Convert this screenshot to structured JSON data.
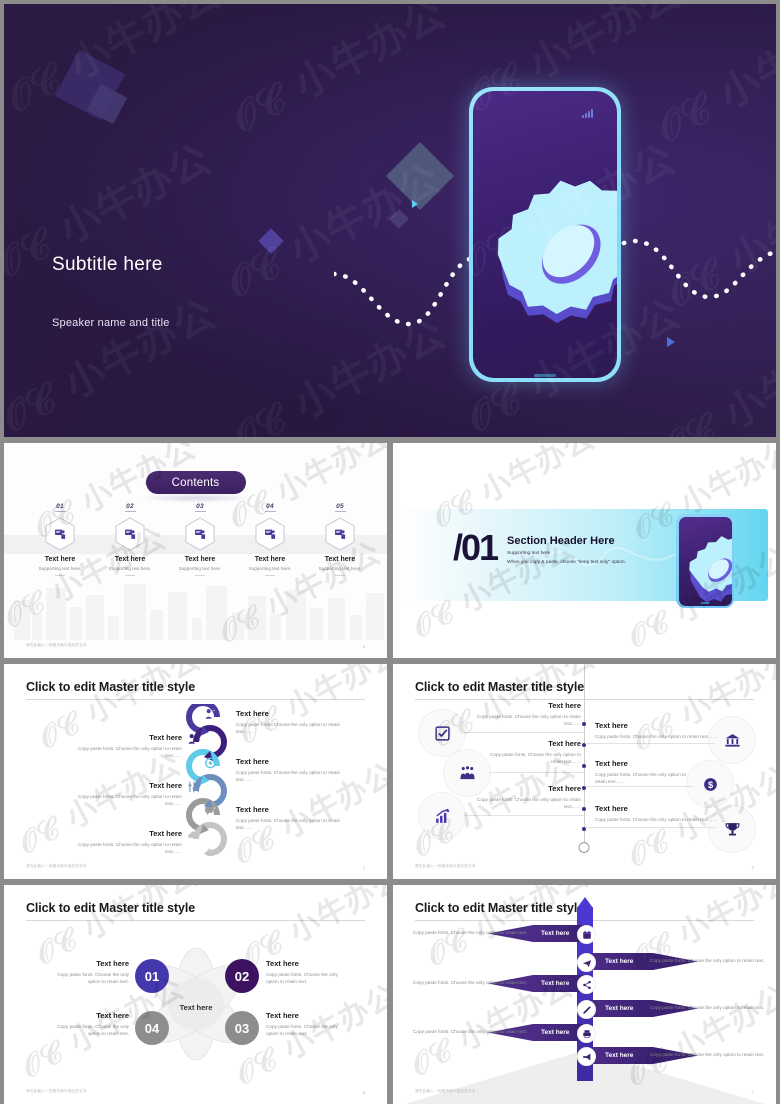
{
  "deck": {
    "watermark_text": "小牛办公",
    "colors": {
      "dark_purple": "#2a1a42",
      "accent_purple": "#4b2c86",
      "deep_violet": "#3c2060",
      "cyan": "#8de2f4",
      "blue_violet": "#4338a8",
      "gray": "#8c8c8c"
    }
  },
  "title_slide": {
    "subtitle": "Subtitle here",
    "speaker": "Speaker name and title",
    "icons": {
      "signal": "signal-bars-icon",
      "gear": "gear-icon",
      "home": "home-indicator"
    }
  },
  "contents_slide": {
    "heading": "Contents",
    "items": [
      {
        "num": "01",
        "label": "Text here",
        "supporting": "Supporting text here.",
        "icon": "presentation-icon"
      },
      {
        "num": "02",
        "label": "Text here",
        "supporting": "Supporting text here.",
        "icon": "presentation-icon"
      },
      {
        "num": "03",
        "label": "Text here",
        "supporting": "Supporting text here.",
        "icon": "presentation-icon"
      },
      {
        "num": "04",
        "label": "Text here",
        "supporting": "Supporting text here.",
        "icon": "presentation-icon"
      },
      {
        "num": "05",
        "label": "Text here",
        "supporting": "Supporting text here.",
        "icon": "presentation-icon"
      }
    ],
    "footer": "请在此输入一页副页面中相应的文本",
    "page_no": "2"
  },
  "section_slide": {
    "number": "/01",
    "heading": "Section Header Here",
    "supporting": "Supporting text here",
    "note": "When you copy & paste, choose \"keep text only\" option."
  },
  "slide_arrows": {
    "title": "Click to edit Master title style",
    "body_text": "Copy paste fonts. Choose the only option to retain text……",
    "items": [
      {
        "label": "Text here",
        "side": "right",
        "icon": "user-group-icon",
        "color": "#4a3a9e"
      },
      {
        "label": "Text here",
        "side": "left",
        "icon": "person-chart-icon",
        "color": "#3c1f7a"
      },
      {
        "label": "Text here",
        "side": "right",
        "icon": "target-icon",
        "color": "#5ecbe8"
      },
      {
        "label": "Text here",
        "side": "left",
        "icon": "sliders-icon",
        "color": "#6d8fc0"
      },
      {
        "label": "Text here",
        "side": "right",
        "icon": "chat-icon",
        "color": "#9b9b9b"
      },
      {
        "label": "Text here",
        "side": "left",
        "icon": "cloud-icon",
        "color": "#c4c4c4"
      }
    ],
    "footer": "请在此输入一页副页面中相应的文本",
    "page_no": "4"
  },
  "slide_timeline": {
    "title": "Click to edit Master title style",
    "body_text": "Copy paste fonts. Choose the only option to retain text……",
    "items": [
      {
        "label": "Text here",
        "side": "left",
        "icon": "checkbox-icon"
      },
      {
        "label": "Text here",
        "side": "right",
        "icon": "bank-icon"
      },
      {
        "label": "Text here",
        "side": "left",
        "icon": "people-icon"
      },
      {
        "label": "Text here",
        "side": "right",
        "icon": "dollar-icon"
      },
      {
        "label": "Text here",
        "side": "left",
        "icon": "growth-chart-icon"
      },
      {
        "label": "Text here",
        "side": "right",
        "icon": "trophy-icon"
      }
    ],
    "footer": "请在此输入一页副页面中相应的文本",
    "page_no": "5"
  },
  "slide_venn": {
    "title": "Click to edit Master title style",
    "center_label": "Text here",
    "body_text": "Copy paste fonts. Choose the only option to retain text.",
    "items": [
      {
        "num": "01",
        "label": "Text here",
        "color": "#4438ad",
        "pos": "top-left"
      },
      {
        "num": "02",
        "label": "Text here",
        "color": "#3d1361",
        "pos": "top-right"
      },
      {
        "num": "03",
        "label": "Text here",
        "color": "#8d8d8d",
        "pos": "bottom-right"
      },
      {
        "num": "04",
        "label": "Text here",
        "color": "#8d8d8d",
        "pos": "bottom-left"
      }
    ],
    "footer": "请在此输入一页副页面中相应的文本",
    "page_no": "6"
  },
  "slide_ribbons": {
    "title": "Click to edit Master title style",
    "body_text": "Copy paste fonts. Choose the only option to retain text.",
    "items": [
      {
        "label": "Text here",
        "side": "left",
        "icon": "calendar-icon"
      },
      {
        "label": "Text here",
        "side": "right",
        "icon": "plane-icon"
      },
      {
        "label": "Text here",
        "side": "left",
        "icon": "share-icon"
      },
      {
        "label": "Text here",
        "side": "right",
        "icon": "pen-icon"
      },
      {
        "label": "Text here",
        "side": "left",
        "icon": "print-icon"
      },
      {
        "label": "Text here",
        "side": "right",
        "icon": "megaphone-icon"
      }
    ],
    "footer": "请在此输入一页副页面中相应的文本",
    "page_no": "7"
  }
}
